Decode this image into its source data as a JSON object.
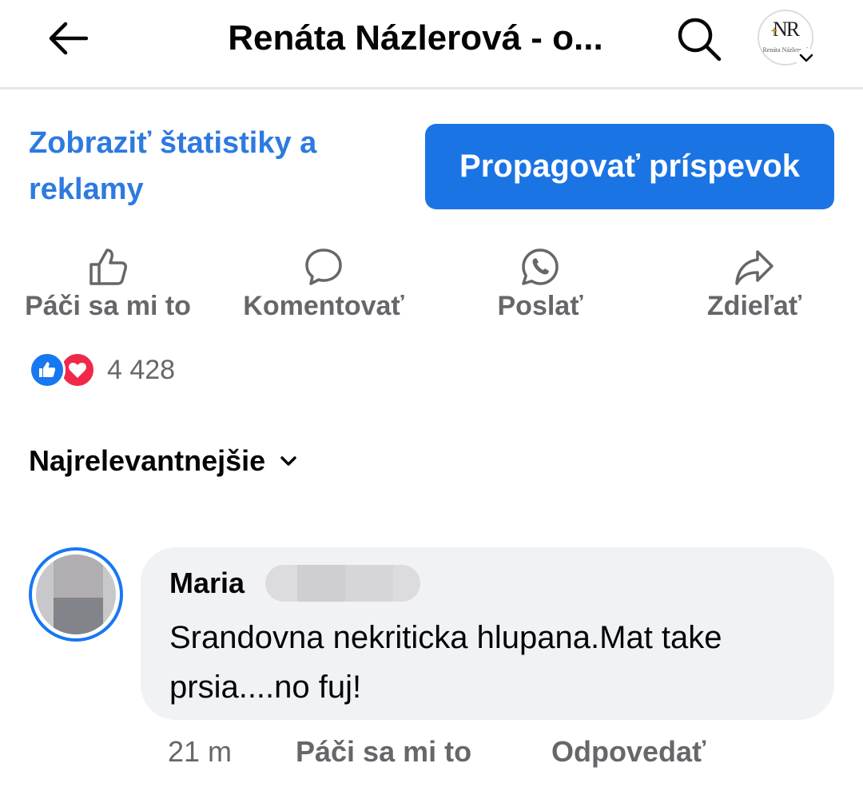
{
  "header": {
    "title": "Renáta Názlerová - o...",
    "profile_logo_text": "NR",
    "profile_logo_subtext": "Renáta Názlerová"
  },
  "actions_bar": {
    "stats_link": "Zobraziť štatistiky a reklamy",
    "promote_button": "Propagovať príspevok"
  },
  "post_actions": [
    {
      "label": "Páči sa mi to",
      "icon": "thumbs-up-icon"
    },
    {
      "label": "Komentovať",
      "icon": "comment-icon"
    },
    {
      "label": "Poslať",
      "icon": "whatsapp-icon"
    },
    {
      "label": "Zdieľať",
      "icon": "share-icon"
    }
  ],
  "reactions": {
    "count": "4 428",
    "types": [
      "like",
      "love"
    ]
  },
  "sort": {
    "label": "Najrelevantnejšie"
  },
  "comment": {
    "author": "Maria",
    "text": "Srandovna nekriticka hlupana.Mat take prsia....no fuj!",
    "time": "21 m",
    "like_label": "Páči sa mi to",
    "reply_label": "Odpovedať"
  },
  "colors": {
    "link_blue": "#2d7ae0",
    "button_blue": "#1b74e4",
    "secondary_text": "#65676b",
    "bubble_bg": "#f0f2f5"
  }
}
